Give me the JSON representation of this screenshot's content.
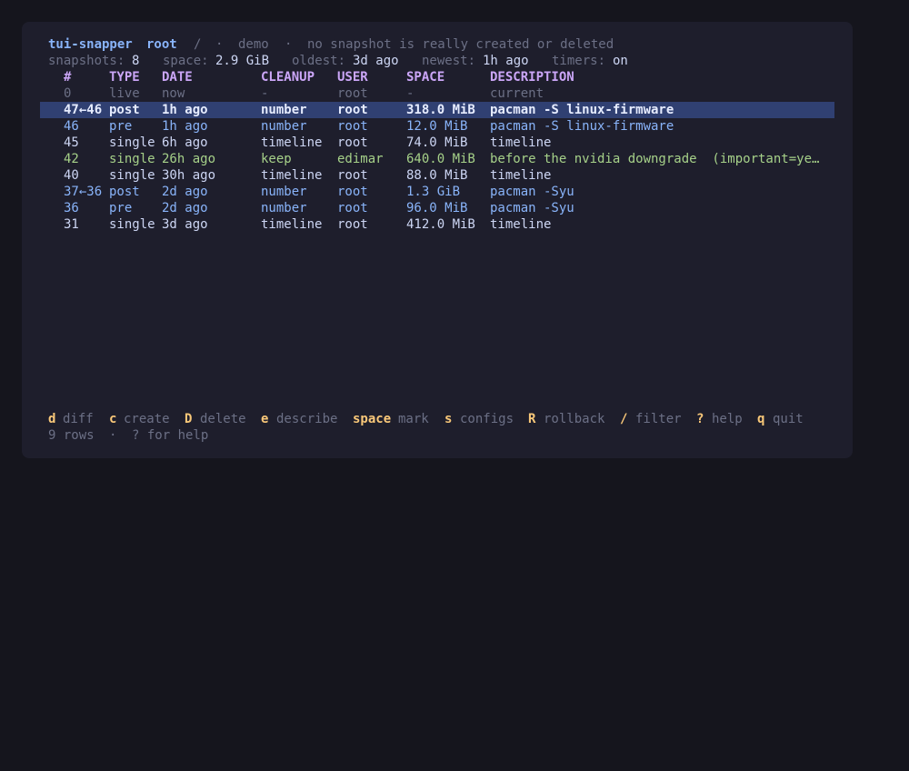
{
  "header": {
    "app_name": "tui-snapper",
    "config": "root",
    "sep1": "/",
    "dot1": "·",
    "mode": "demo",
    "dot2": "·",
    "note": "no snapshot is really created or deleted"
  },
  "stats": {
    "snapshots_label": "snapshots:",
    "snapshots_value": "8",
    "space_label": "space:",
    "space_value": "2.9 GiB",
    "oldest_label": "oldest:",
    "oldest_value": "3d ago",
    "newest_label": "newest:",
    "newest_value": "1h ago",
    "timers_label": "timers:",
    "timers_value": "on"
  },
  "table": {
    "columns": [
      "#",
      "TYPE",
      "DATE",
      "CLEANUP",
      "USER",
      "SPACE",
      "DESCRIPTION"
    ],
    "rows": [
      {
        "num": "0",
        "type": "live",
        "date": "now",
        "cleanup": "-",
        "user": "root",
        "space": "-",
        "description": "current"
      },
      {
        "num": "47←46",
        "type": "post",
        "date": "1h ago",
        "cleanup": "number",
        "user": "root",
        "space": "318.0 MiB",
        "description": "pacman -S linux-firmware"
      },
      {
        "num": "46",
        "type": "pre",
        "date": "1h ago",
        "cleanup": "number",
        "user": "root",
        "space": "12.0 MiB",
        "description": "pacman -S linux-firmware"
      },
      {
        "num": "45",
        "type": "single",
        "date": "6h ago",
        "cleanup": "timeline",
        "user": "root",
        "space": "74.0 MiB",
        "description": "timeline"
      },
      {
        "num": "42",
        "type": "single",
        "date": "26h ago",
        "cleanup": "keep",
        "user": "edimar",
        "space": "640.0 MiB",
        "description": "before the nvidia downgrade  (important=ye…"
      },
      {
        "num": "40",
        "type": "single",
        "date": "30h ago",
        "cleanup": "timeline",
        "user": "root",
        "space": "88.0 MiB",
        "description": "timeline"
      },
      {
        "num": "37←36",
        "type": "post",
        "date": "2d ago",
        "cleanup": "number",
        "user": "root",
        "space": "1.3 GiB",
        "description": "pacman -Syu"
      },
      {
        "num": "36",
        "type": "pre",
        "date": "2d ago",
        "cleanup": "number",
        "user": "root",
        "space": "96.0 MiB",
        "description": "pacman -Syu"
      },
      {
        "num": "31",
        "type": "single",
        "date": "3d ago",
        "cleanup": "timeline",
        "user": "root",
        "space": "412.0 MiB",
        "description": "timeline"
      }
    ]
  },
  "keybar": [
    {
      "key": "d",
      "label": "diff"
    },
    {
      "key": "c",
      "label": "create"
    },
    {
      "key": "D",
      "label": "delete"
    },
    {
      "key": "e",
      "label": "describe"
    },
    {
      "key": "space",
      "label": "mark"
    },
    {
      "key": "s",
      "label": "configs"
    },
    {
      "key": "R",
      "label": "rollback"
    },
    {
      "key": "/",
      "label": "filter"
    },
    {
      "key": "?",
      "label": "help"
    },
    {
      "key": "q",
      "label": "quit"
    }
  ],
  "footer": {
    "rows_text": "9 rows",
    "dot": "·",
    "help_text": "? for help"
  },
  "colors": {
    "background": "#15151d",
    "panel": "#1e1e2c",
    "accent_blue": "#89b4fa",
    "header_purple": "#cba6f7",
    "important_green": "#a6d189",
    "key_yellow": "#f9c879",
    "selection": "#304072"
  }
}
